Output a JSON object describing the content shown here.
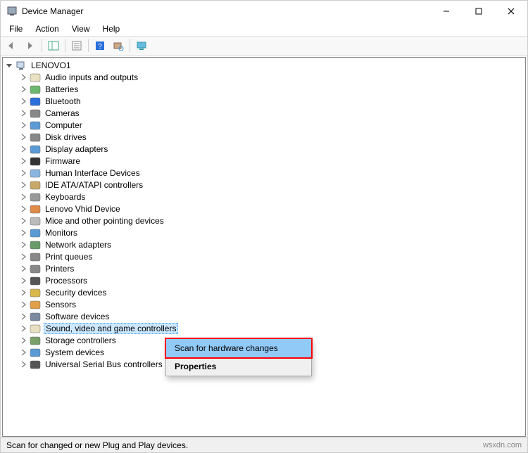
{
  "window": {
    "title": "Device Manager"
  },
  "menubar": [
    "File",
    "Action",
    "View",
    "Help"
  ],
  "tree": {
    "root": "LENOVO1",
    "items": [
      "Audio inputs and outputs",
      "Batteries",
      "Bluetooth",
      "Cameras",
      "Computer",
      "Disk drives",
      "Display adapters",
      "Firmware",
      "Human Interface Devices",
      "IDE ATA/ATAPI controllers",
      "Keyboards",
      "Lenovo Vhid Device",
      "Mice and other pointing devices",
      "Monitors",
      "Network adapters",
      "Print queues",
      "Printers",
      "Processors",
      "Security devices",
      "Sensors",
      "Software devices",
      "Sound, video and game controllers",
      "Storage controllers",
      "System devices",
      "Universal Serial Bus controllers"
    ],
    "selected": "Sound, video and game controllers"
  },
  "context_menu": {
    "scan": "Scan for hardware changes",
    "properties": "Properties"
  },
  "statusbar": {
    "text": "Scan for changed or new Plug and Play devices."
  },
  "watermark": "wsxdn.com",
  "icons": {
    "Audio inputs and outputs": {
      "bg": "#e8e0c0",
      "fg": "#555",
      "glyph": "s"
    },
    "Batteries": {
      "bg": "#6db86d",
      "fg": "#fff",
      "glyph": "b"
    },
    "Bluetooth": {
      "bg": "#2a6fdb",
      "fg": "#fff",
      "glyph": "bt"
    },
    "Cameras": {
      "bg": "#888",
      "fg": "#fff",
      "glyph": "cam"
    },
    "Computer": {
      "bg": "#5a9bd5",
      "fg": "#fff",
      "glyph": "pc"
    },
    "Disk drives": {
      "bg": "#888",
      "fg": "#fff",
      "glyph": "d"
    },
    "Display adapters": {
      "bg": "#5a9bd5",
      "fg": "#fff",
      "glyph": "m"
    },
    "Firmware": {
      "bg": "#333",
      "fg": "#fff",
      "glyph": "f"
    },
    "Human Interface Devices": {
      "bg": "#8ab5e0",
      "fg": "#333",
      "glyph": "h"
    },
    "IDE ATA/ATAPI controllers": {
      "bg": "#c9a86a",
      "fg": "#333",
      "glyph": "i"
    },
    "Keyboards": {
      "bg": "#999",
      "fg": "#fff",
      "glyph": "kb"
    },
    "Lenovo Vhid Device": {
      "bg": "#e08a4a",
      "fg": "#fff",
      "glyph": "l"
    },
    "Mice and other pointing devices": {
      "bg": "#bbb",
      "fg": "#333",
      "glyph": "ms"
    },
    "Monitors": {
      "bg": "#5a9bd5",
      "fg": "#fff",
      "glyph": "m"
    },
    "Network adapters": {
      "bg": "#6a9a6a",
      "fg": "#fff",
      "glyph": "n"
    },
    "Print queues": {
      "bg": "#888",
      "fg": "#fff",
      "glyph": "p"
    },
    "Printers": {
      "bg": "#888",
      "fg": "#fff",
      "glyph": "p"
    },
    "Processors": {
      "bg": "#555",
      "fg": "#fff",
      "glyph": "c"
    },
    "Security devices": {
      "bg": "#d8b84a",
      "fg": "#333",
      "glyph": "k"
    },
    "Sensors": {
      "bg": "#e0a04a",
      "fg": "#fff",
      "glyph": "s"
    },
    "Software devices": {
      "bg": "#7a8aa0",
      "fg": "#fff",
      "glyph": "sw"
    },
    "Sound, video and game controllers": {
      "bg": "#e8e0c0",
      "fg": "#555",
      "glyph": "s"
    },
    "Storage controllers": {
      "bg": "#7aa06a",
      "fg": "#fff",
      "glyph": "st"
    },
    "System devices": {
      "bg": "#5a9bd5",
      "fg": "#fff",
      "glyph": "pc"
    },
    "Universal Serial Bus controllers": {
      "bg": "#555",
      "fg": "#fff",
      "glyph": "u"
    }
  }
}
